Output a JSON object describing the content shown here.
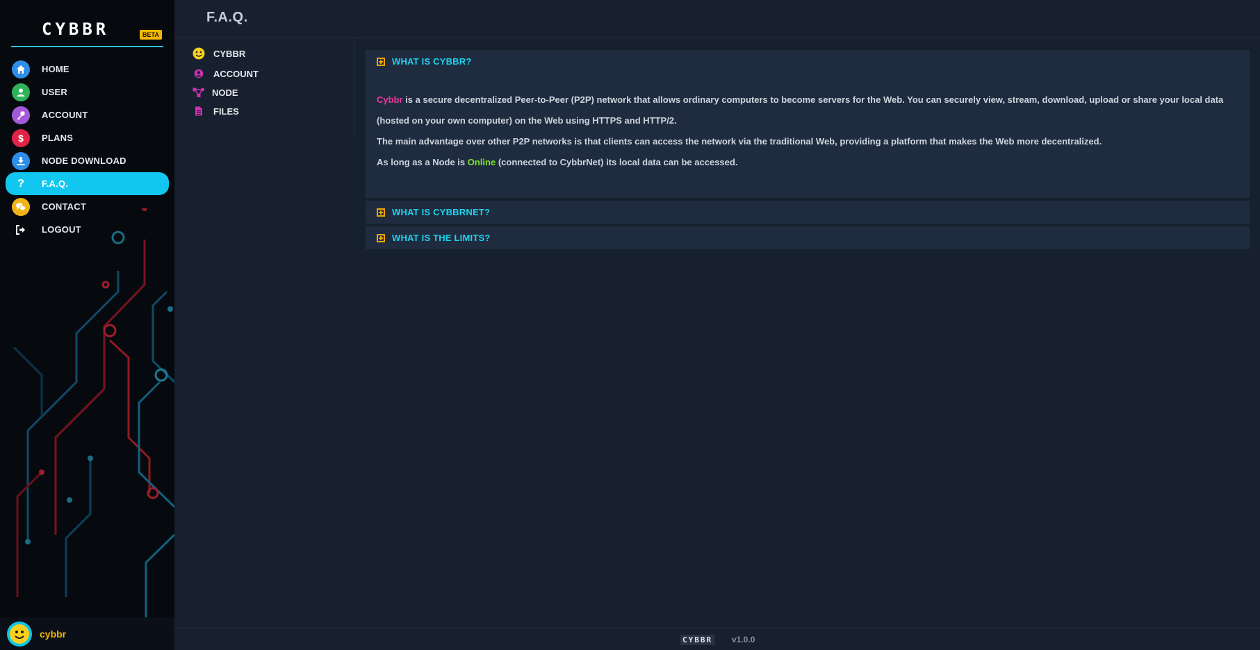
{
  "brand": {
    "logo": "CYBBR",
    "badge": "BETA"
  },
  "sidebar": {
    "items": [
      {
        "label": "HOME",
        "icon": "home-icon",
        "color": "#2c8ee8"
      },
      {
        "label": "USER",
        "icon": "user-icon",
        "color": "#2fb35a"
      },
      {
        "label": "ACCOUNT",
        "icon": "key-icon",
        "color": "#a35ad8"
      },
      {
        "label": "PLANS",
        "icon": "dollar-icon",
        "color": "#e02346"
      },
      {
        "label": "NODE DOWNLOAD",
        "icon": "download-icon",
        "color": "#2c8ee8"
      },
      {
        "label": "F.A.Q.",
        "icon": "question-icon",
        "color": "#11c7ef",
        "active": true
      },
      {
        "label": "CONTACT",
        "icon": "chat-icon",
        "color": "#f0b41a"
      },
      {
        "label": "LOGOUT",
        "icon": "logout-icon",
        "color": "transparent"
      }
    ]
  },
  "user": {
    "name": "cybbr"
  },
  "header": {
    "title": "F.A.Q."
  },
  "subnav": {
    "items": [
      {
        "label": "CYBBR",
        "icon": "smiley-icon"
      },
      {
        "label": "ACCOUNT",
        "icon": "user-circle-icon"
      },
      {
        "label": "NODE",
        "icon": "network-icon"
      },
      {
        "label": "FILES",
        "icon": "file-icon"
      }
    ]
  },
  "faq": {
    "items": [
      {
        "question": "WHAT IS CYBBR?",
        "expanded": true,
        "p1_brand": "Cybbr",
        "p1_rest": " is a secure decentralized Peer-to-Peer (P2P) network that allows ordinary computers to become servers for the Web. You can securely view, stream, download, upload or share your local data (hosted on your own computer) on the Web using HTTPS and HTTP/2.",
        "p2": "The main advantage over other P2P networks is that clients can access the network via the traditional Web, providing a platform that makes the Web more decentralized.",
        "p3_pre": "As long as a Node is ",
        "p3_status": "Online",
        "p3_post": " (connected to CybbrNet) its local data can be accessed."
      },
      {
        "question": "WHAT IS CYBBRNET?",
        "expanded": false
      },
      {
        "question": "WHAT IS THE LIMITS?",
        "expanded": false
      }
    ]
  },
  "footer": {
    "logo": "CYBBR",
    "version": "v1.0.0"
  },
  "colors": {
    "accent": "#11c7ef",
    "question": "#1ed3ee",
    "brand_pink": "#e73a9c",
    "online_green": "#7ee22e",
    "badge": "#f5b800"
  }
}
